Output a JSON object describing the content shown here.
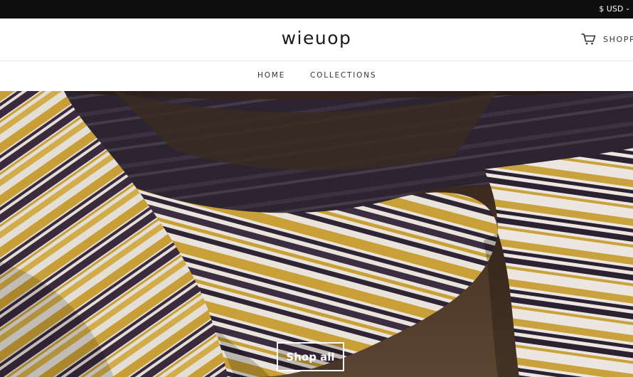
{
  "topbar": {
    "currency_label": "$ USD",
    "currency_icon": "chevron-down-icon"
  },
  "header": {
    "logo": "wieuop",
    "cart_label": "SHOPP",
    "cart_icon": "cart-icon"
  },
  "nav": {
    "items": [
      {
        "label": "HOME"
      },
      {
        "label": "COLLECTIONS"
      }
    ]
  },
  "hero": {
    "button_label": "Shop all"
  },
  "colors": {
    "topbar_bg": "#0e0e0e",
    "header_bg": "#ffffff",
    "text": "#222222",
    "blanket_gold": "#c9a23a",
    "blanket_purple": "#3b2a3f",
    "blanket_white": "#e8e4dc",
    "background_brown": "#3a2a20"
  }
}
